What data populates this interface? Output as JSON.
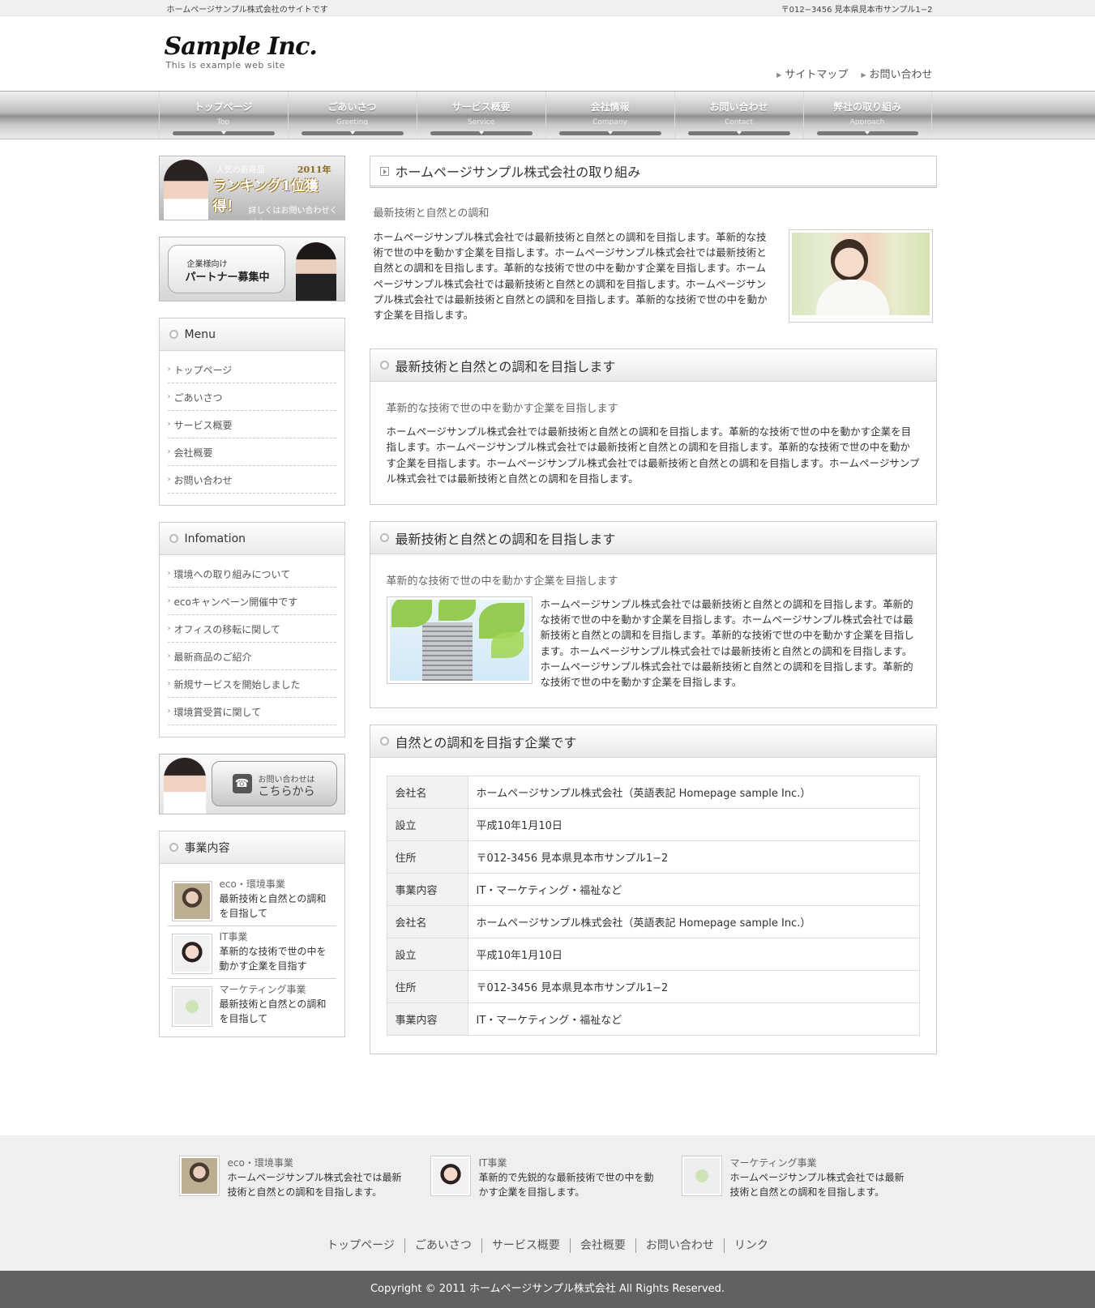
{
  "topbar": {
    "left": "ホームページサンプル株式会社のサイトです",
    "right": "〒012−3456 見本県見本市サンプル1−2"
  },
  "logo": {
    "main": "Sample Inc.",
    "sub": "This is example web site"
  },
  "header_links": [
    "サイトマップ",
    "お問い合わせ"
  ],
  "nav": [
    {
      "jp": "トップページ",
      "en": "Top"
    },
    {
      "jp": "ごあいさつ",
      "en": "Greeting"
    },
    {
      "jp": "サービス概要",
      "en": "Service"
    },
    {
      "jp": "会社情報",
      "en": "Company"
    },
    {
      "jp": "お問い合わせ",
      "en": "Contact"
    },
    {
      "jp": "弊社の取り組み",
      "en": "Approach"
    }
  ],
  "banner1": {
    "small": "人気の新商品",
    "year": "2011年",
    "big": "ランキング1位獲得！",
    "sub": "詳しくはお問い合わせください"
  },
  "banner2": {
    "small": "企業様向け",
    "big": "パートナー募集中"
  },
  "menu": {
    "title": "Menu",
    "items": [
      "トップページ",
      "ごあいさつ",
      "サービス概要",
      "会社概要",
      "お問い合わせ"
    ]
  },
  "info": {
    "title": "Infomation",
    "items": [
      "環境への取り組みについて",
      "ecoキャンペーン開催中です",
      "オフィスの移転に関して",
      "最新商品のご紹介",
      "新規サービスを開始しました",
      "環境賞受賞に関して"
    ]
  },
  "banner3": {
    "small": "お問い合わせは",
    "big": "こちらから"
  },
  "business": {
    "title": "事業内容",
    "items": [
      {
        "cat": "eco・環境事業",
        "line1": "最新技術と自然との調和",
        "line2": "を目指して"
      },
      {
        "cat": "IT事業",
        "line1": "革新的な技術で世の中を",
        "line2": "動かす企業を目指す"
      },
      {
        "cat": "マーケティング事業",
        "line1": "最新技術と自然との調和",
        "line2": "を目指して"
      }
    ]
  },
  "content": {
    "page_title": "ホームページサンプル株式会社の取り組み",
    "intro_sub": "最新技術と自然との調和",
    "intro_text": "ホームページサンプル株式会社では最新技術と自然との調和を目指します。革新的な技術で世の中を動かす企業を目指します。ホームページサンプル株式会社では最新技術と自然との調和を目指します。革新的な技術で世の中を動かす企業を目指します。ホームページサンプル株式会社では最新技術と自然との調和を目指します。ホームページサンプル株式会社では最新技術と自然との調和を目指します。革新的な技術で世の中を動かす企業を目指します。",
    "box1": {
      "title": "最新技術と自然との調和を目指します",
      "sub": "革新的な技術で世の中を動かす企業を目指します",
      "text": "ホームページサンプル株式会社では最新技術と自然との調和を目指します。革新的な技術で世の中を動かす企業を目指します。ホームページサンプル株式会社では最新技術と自然との調和を目指します。革新的な技術で世の中を動かす企業を目指します。ホームページサンプル株式会社では最新技術と自然との調和を目指します。ホームページサンプル株式会社では最新技術と自然との調和を目指します。"
    },
    "box2": {
      "title": "最新技術と自然との調和を目指します",
      "sub": "革新的な技術で世の中を動かす企業を目指します",
      "text": "ホームページサンプル株式会社では最新技術と自然との調和を目指します。革新的な技術で世の中を動かす企業を目指します。ホームページサンプル株式会社では最新技術と自然との調和を目指します。革新的な技術で世の中を動かす企業を目指します。ホームページサンプル株式会社では最新技術と自然との調和を目指します。ホームページサンプル株式会社では最新技術と自然との調和を目指します。革新的な技術で世の中を動かす企業を目指します。"
    },
    "box3": {
      "title": "自然との調和を目指す企業です",
      "rows": [
        {
          "k": "会社名",
          "v": "ホームページサンプル株式会社（英語表記 Homepage sample Inc.）"
        },
        {
          "k": "設立",
          "v": "平成10年1月10日"
        },
        {
          "k": "住所",
          "v": "〒012-3456 見本県見本市サンプル1−2"
        },
        {
          "k": "事業内容",
          "v": "IT・マーケティング・福祉など"
        },
        {
          "k": "会社名",
          "v": "ホームページサンプル株式会社（英語表記 Homepage sample Inc.）"
        },
        {
          "k": "設立",
          "v": "平成10年1月10日"
        },
        {
          "k": "住所",
          "v": "〒012-3456 見本県見本市サンプル1−2"
        },
        {
          "k": "事業内容",
          "v": "IT・マーケティング・福祉など"
        }
      ]
    }
  },
  "footer": {
    "cols": [
      {
        "cat": "eco・環境事業",
        "line1": "ホームページサンプル株式会社では最新",
        "line2": "技術と自然との調和を目指します。"
      },
      {
        "cat": "IT事業",
        "line1": "革新的で先鋭的な最新技術で世の中を動",
        "line2": "かす企業を目指します。"
      },
      {
        "cat": "マーケティング事業",
        "line1": "ホームページサンプル株式会社では最新",
        "line2": "技術と自然との調和を目指します。"
      }
    ],
    "nav": [
      "トップページ",
      "ごあいさつ",
      "サービス概要",
      "会社概要",
      "お問い合わせ",
      "リンク"
    ],
    "copyright": "Copyright © 2011 ホームページサンプル株式会社 All Rights Reserved."
  }
}
